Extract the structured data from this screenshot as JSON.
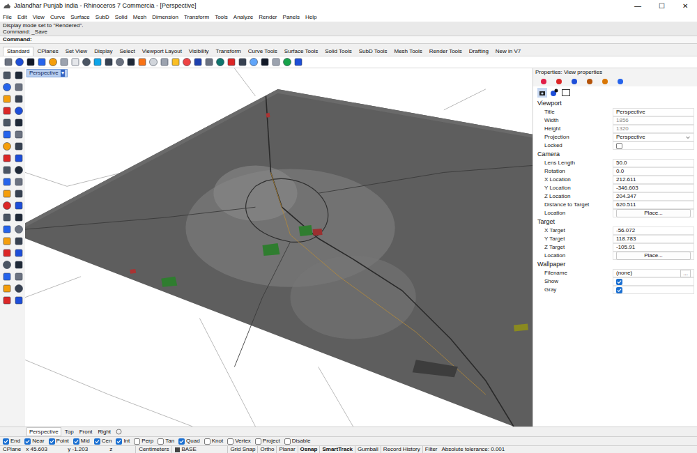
{
  "window": {
    "title": "Jalandhar Punjab India - Rhinoceros 7 Commercia - [Perspective]",
    "controls": [
      "—",
      "☐",
      "✕"
    ]
  },
  "menu": [
    "File",
    "Edit",
    "View",
    "Curve",
    "Surface",
    "SubD",
    "Solid",
    "Mesh",
    "Dimension",
    "Transform",
    "Tools",
    "Analyze",
    "Render",
    "Panels",
    "Help"
  ],
  "command_history": [
    "Display mode set to \"Rendered\".",
    "Command: _Save"
  ],
  "command_prompt": "Command:",
  "toolbar_tabs": [
    {
      "label": "Standard",
      "selected": true
    },
    {
      "label": "CPlanes",
      "selected": false
    },
    {
      "label": "Set View",
      "selected": false
    },
    {
      "label": "Display",
      "selected": false
    },
    {
      "label": "Select",
      "selected": false
    },
    {
      "label": "Viewport Layout",
      "selected": false
    },
    {
      "label": "Visibility",
      "selected": false
    },
    {
      "label": "Transform",
      "selected": false
    },
    {
      "label": "Curve Tools",
      "selected": false
    },
    {
      "label": "Surface Tools",
      "selected": false
    },
    {
      "label": "Solid Tools",
      "selected": false
    },
    {
      "label": "SubD Tools",
      "selected": false
    },
    {
      "label": "Mesh Tools",
      "selected": false
    },
    {
      "label": "Render Tools",
      "selected": false
    },
    {
      "label": "Drafting",
      "selected": false
    },
    {
      "label": "New in V7",
      "selected": false
    }
  ],
  "viewport": {
    "title": "Perspective",
    "arrow": "▾"
  },
  "viewport_tabs": [
    {
      "label": "Perspective",
      "selected": true
    },
    {
      "label": "Top",
      "selected": false
    },
    {
      "label": "Front",
      "selected": false
    },
    {
      "label": "Right",
      "selected": false
    }
  ],
  "properties": {
    "header": "Properties: View properties",
    "sections": [
      {
        "title": "Viewport",
        "rows": [
          {
            "label": "Title",
            "kind": "text",
            "value": "Perspective",
            "disabled": false
          },
          {
            "label": "Width",
            "kind": "text",
            "value": "1856",
            "disabled": true
          },
          {
            "label": "Height",
            "kind": "text",
            "value": "1320",
            "disabled": true
          },
          {
            "label": "Projection",
            "kind": "dropdown",
            "value": "Perspective",
            "disabled": false
          },
          {
            "label": "Locked",
            "kind": "checkbox",
            "checked": false,
            "disabled": false
          }
        ]
      },
      {
        "title": "Camera",
        "rows": [
          {
            "label": "Lens Length",
            "kind": "text",
            "value": "50.0",
            "disabled": false
          },
          {
            "label": "Rotation",
            "kind": "text",
            "value": "0.0",
            "disabled": false
          },
          {
            "label": "X Location",
            "kind": "text",
            "value": "212.611",
            "disabled": false
          },
          {
            "label": "Y Location",
            "kind": "text",
            "value": "-346.603",
            "disabled": false
          },
          {
            "label": "Z Location",
            "kind": "text",
            "value": "204.347",
            "disabled": false
          },
          {
            "label": "Distance to Target",
            "kind": "text",
            "value": "620.511",
            "disabled": false
          },
          {
            "label": "Location",
            "kind": "button",
            "value": "Place...",
            "disabled": false
          }
        ]
      },
      {
        "title": "Target",
        "rows": [
          {
            "label": "X Target",
            "kind": "text",
            "value": "-56.072",
            "disabled": false
          },
          {
            "label": "Y Target",
            "kind": "text",
            "value": "118.783",
            "disabled": false
          },
          {
            "label": "Z Target",
            "kind": "text",
            "value": "-105.91",
            "disabled": false
          },
          {
            "label": "Location",
            "kind": "button",
            "value": "Place...",
            "disabled": false
          }
        ]
      },
      {
        "title": "Wallpaper",
        "rows": [
          {
            "label": "Filename",
            "kind": "file",
            "value": "(none)",
            "button": "...",
            "disabled": false
          },
          {
            "label": "Show",
            "kind": "checkbox",
            "checked": true,
            "disabled": false
          },
          {
            "label": "Gray",
            "kind": "checkbox",
            "checked": true,
            "disabled": false
          }
        ]
      }
    ]
  },
  "osnaps": [
    {
      "label": "End",
      "checked": true
    },
    {
      "label": "Near",
      "checked": true
    },
    {
      "label": "Point",
      "checked": true
    },
    {
      "label": "Mid",
      "checked": true
    },
    {
      "label": "Cen",
      "checked": true
    },
    {
      "label": "Int",
      "checked": true
    },
    {
      "label": "Perp",
      "checked": false
    },
    {
      "label": "Tan",
      "checked": false
    },
    {
      "label": "Quad",
      "checked": true
    },
    {
      "label": "Knot",
      "checked": false
    },
    {
      "label": "Vertex",
      "checked": false
    },
    {
      "label": "Project",
      "checked": false
    },
    {
      "label": "Disable",
      "checked": false
    }
  ],
  "status_bar": {
    "cplane": "CPlane",
    "x": "x 45.603",
    "y": "y -1.203",
    "z": "z",
    "units": "Centimeters",
    "layer": "BASE",
    "toggles": [
      {
        "label": "Grid Snap",
        "on": false
      },
      {
        "label": "Ortho",
        "on": false
      },
      {
        "label": "Planar",
        "on": false
      },
      {
        "label": "Osnap",
        "on": true
      },
      {
        "label": "SmartTrack",
        "on": true
      },
      {
        "label": "Gumball",
        "on": false
      },
      {
        "label": "Record History",
        "on": false
      },
      {
        "label": "Filter",
        "on": false
      }
    ],
    "tolerance": "Absolute tolerance: 0.001"
  }
}
